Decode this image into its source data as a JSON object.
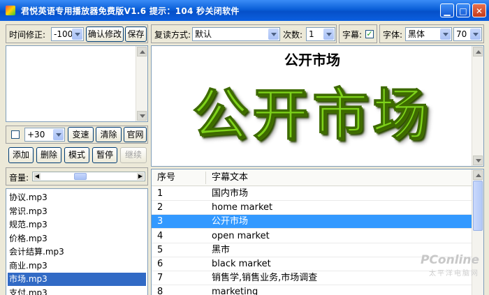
{
  "window": {
    "title": "君悦英语专用播放器免费版V1.6 提示：104 秒关闭软件",
    "minimize_glyph": "▁",
    "maximize_glyph": "□",
    "close_glyph": "✕"
  },
  "toolbar_time": {
    "label": "时间修正:",
    "value": "-100",
    "confirm_label": "确认修改",
    "save_label": "保存"
  },
  "toolbar_repeat": {
    "mode_label": "复读方式:",
    "mode_value": "默认",
    "count_label": "次数:",
    "count_value": "1"
  },
  "toolbar_subtitle": {
    "label": "字幕:",
    "checked": true
  },
  "toolbar_font": {
    "label": "字体:",
    "font_value": "黑体",
    "size_value": "70"
  },
  "controls": {
    "speed_value": "+30",
    "speed_checked": false,
    "speed_button": "变速",
    "clear_button": "清除",
    "website_button": "官网",
    "add_button": "添加",
    "delete_button": "删除",
    "mode_button": "模式",
    "pause_button": "暂停",
    "resume_button": "继续"
  },
  "volume": {
    "label": "音量:",
    "level": 0.4
  },
  "playlist": [
    "协议.mp3",
    "常识.mp3",
    "规范.mp3",
    "价格.mp3",
    "会计结算.mp3",
    "商业.mp3",
    "市场.mp3",
    "支付.mp3"
  ],
  "playlist_selected_index": 6,
  "display": {
    "small_text": "公开市场",
    "big_text": "公开市场"
  },
  "subtitle_table": {
    "headers": [
      "序号",
      "字幕文本"
    ],
    "rows": [
      [
        "1",
        "国内市场"
      ],
      [
        "2",
        "home market"
      ],
      [
        "3",
        "公开市场"
      ],
      [
        "4",
        "open market"
      ],
      [
        "5",
        "黑市"
      ],
      [
        "6",
        "black market"
      ],
      [
        "7",
        "销售学,销售业务,市场调查"
      ],
      [
        "8",
        "marketing"
      ]
    ],
    "selected_index": 2
  },
  "watermark": {
    "brand": "PConline",
    "sub": "太平洋电脑网"
  },
  "colors": {
    "titlebar": "#0a5fd8",
    "selection": "#316ac5",
    "grid_selection": "#3399ff",
    "big_text": "#7ed31a"
  }
}
